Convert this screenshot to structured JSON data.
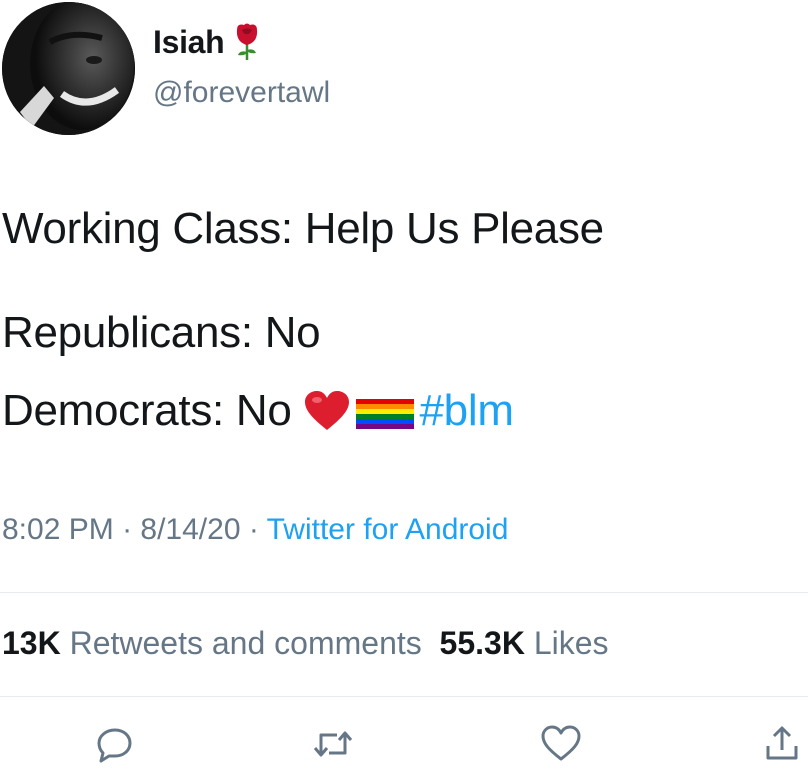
{
  "user": {
    "display_name": "Isiah",
    "handle": "@forevertawl",
    "name_emoji": "rose-icon"
  },
  "tweet": {
    "line1": "Working Class: Help Us Please",
    "line2": "Republicans: No",
    "line3_text": "Democrats: No",
    "line3_emojis": [
      "red-heart-icon",
      "rainbow-flag-icon"
    ],
    "hashtag": "#blm"
  },
  "meta": {
    "time": "8:02 PM",
    "separator": " · ",
    "date": "8/14/20",
    "source": "Twitter for Android"
  },
  "stats": {
    "retweets_count": "13K",
    "retweets_label": "Retweets and comments",
    "likes_count": "55.3K",
    "likes_label": "Likes"
  },
  "actions": [
    {
      "name": "reply",
      "icon": "reply-icon"
    },
    {
      "name": "retweet",
      "icon": "retweet-icon"
    },
    {
      "name": "like",
      "icon": "heart-icon"
    },
    {
      "name": "share",
      "icon": "share-icon"
    }
  ],
  "colors": {
    "text": "#14171a",
    "secondary": "#657786",
    "link": "#1da1f2",
    "divider": "#e6ecf0"
  }
}
